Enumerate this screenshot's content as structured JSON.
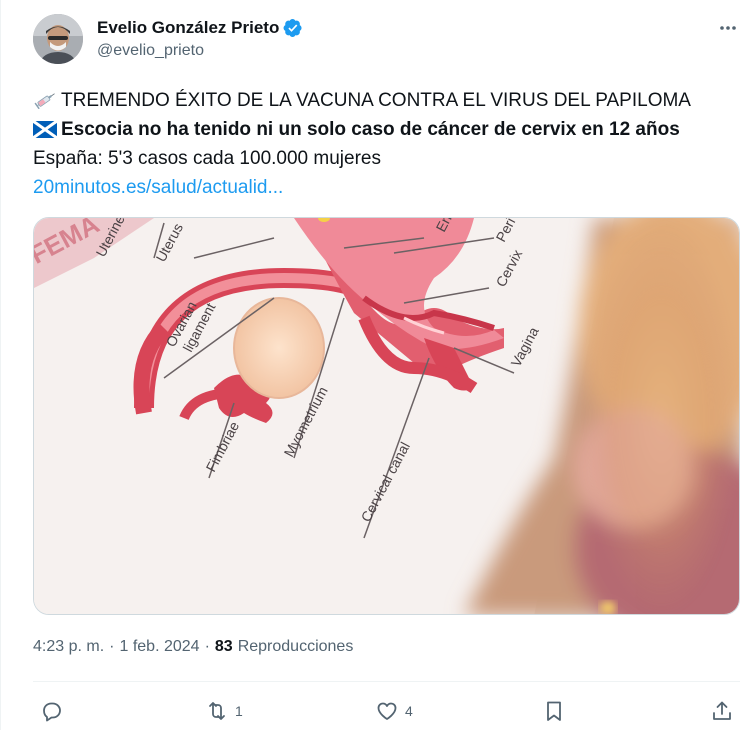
{
  "author": {
    "display_name": "Evelio González Prieto",
    "handle": "@evelio_prieto",
    "verified": true
  },
  "tweet": {
    "line1_emoji": "syringe-icon",
    "line1": "TREMENDO ÉXITO DE LA VACUNA CONTRA EL VIRUS DEL PAPILOMA",
    "line2_emoji": "scotland-flag-icon",
    "line2": "Escocia no ha tenido ni un solo caso de cáncer de cervix en 12 años",
    "line3": "España: 5'3 casos cada 100.000 mujeres",
    "link": "20minutos.es/salud/actualid..."
  },
  "media": {
    "diagram_labels": {
      "fema": "FEMA",
      "uterine": "Uterine",
      "uterus": "Uterus",
      "endo": "Endo",
      "peri": "Peri",
      "cervix": "Cervix",
      "vagina": "Vagina",
      "ovarian1": "Ovarian",
      "ovarian2": "ligament",
      "fimbriae": "Fimbriae",
      "myometrium": "Myometrium",
      "cervical_canal": "Cervical canal"
    }
  },
  "meta": {
    "time": "4:23 p. m.",
    "separator": "·",
    "date": "1 feb. 2024",
    "views_count": "83",
    "views_label": "Reproducciones"
  },
  "actions": {
    "replies": "",
    "retweets": "1",
    "likes": "4"
  },
  "colors": {
    "accent": "#1d9bf0",
    "secondary_text": "#536471",
    "primary_text": "#0f1419"
  }
}
